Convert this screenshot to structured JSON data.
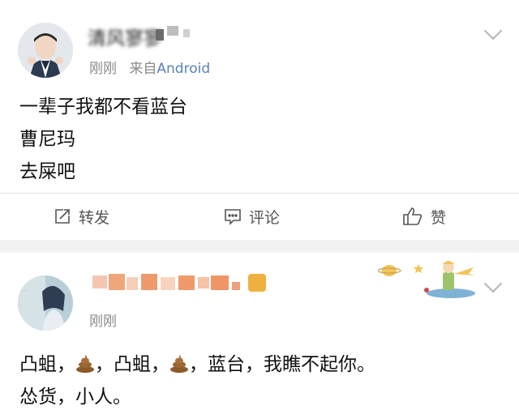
{
  "post1": {
    "username": "清风寥寥",
    "time": "刚刚",
    "source_prefix": "来自",
    "source": "Android",
    "lines": [
      "一辈子我都不看蓝台",
      "曹尼玛",
      "去屎吧"
    ],
    "actions": {
      "repost": "转发",
      "comment": "评论",
      "like": "赞"
    }
  },
  "post2": {
    "time": "刚刚",
    "line1_parts": [
      "凸蛆，",
      "，凸蛆，",
      "，蓝台，我瞧不起你。"
    ],
    "line2": "怂货，小人。"
  },
  "icons": {
    "dropdown": "chevron-down-icon",
    "repost": "repost-icon",
    "comment": "comment-icon",
    "like": "thumbs-up-icon",
    "emoji": "poop-emoji-icon"
  },
  "colors": {
    "source_link": "#5a82b8",
    "meta": "#8a8a8a",
    "background": "#f2f2f2"
  }
}
